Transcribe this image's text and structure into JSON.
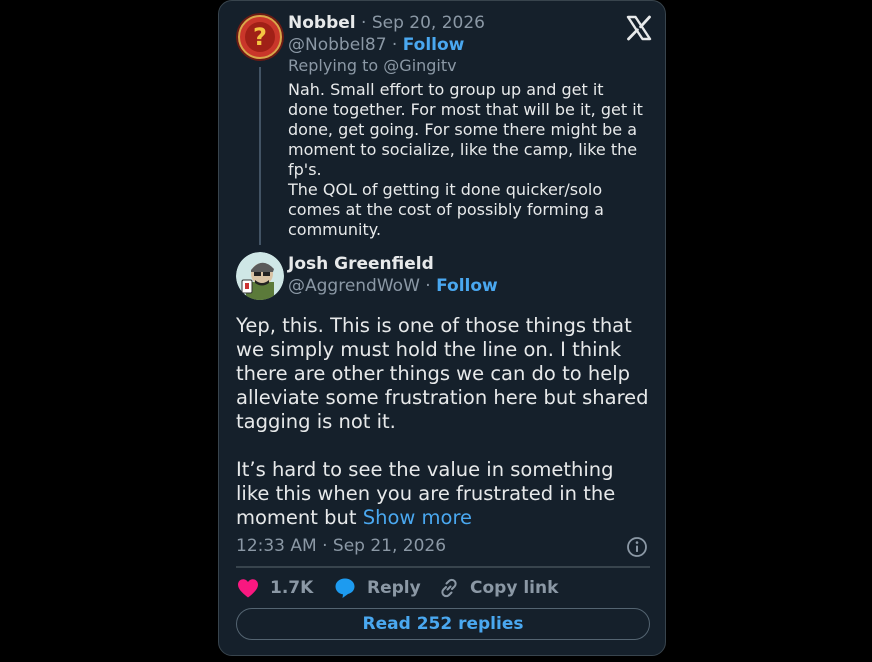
{
  "quoted": {
    "author_name": "Nobbel",
    "date": "· Sep 20, 2026",
    "handle": "@Nobbel87 ·",
    "follow_label": "Follow",
    "replying_to": "Replying to @Gingitv",
    "text_lines": [
      "Nah. Small effort to group up and get it done together. For most that will be it, get it done, get going. For some there might be a moment to socialize, like the camp, like the fp's.",
      "The QOL of getting it done quicker/solo comes at the cost of possibly forming a community."
    ]
  },
  "tweet": {
    "author_name": "Josh Greenfield",
    "handle": "@AggrendWoW ·",
    "follow_label": "Follow",
    "paragraph_1": "Yep, this. This is one of those things that we simply must hold the line on. I think there are other things we can do to help alleviate some frustration here but shared tagging is not it.",
    "paragraph_2": "It’s hard to see the value in something like this when you are frustrated in the moment but",
    "show_more_label": "Show more",
    "timestamp": "12:33 AM · Sep 21, 2026"
  },
  "actions": {
    "likes": "1.7K",
    "reply_label": "Reply",
    "copy_link_label": "Copy link"
  },
  "read_replies_label": "Read 252 replies",
  "icons": {
    "close": "x-logo-icon",
    "info": "info-icon",
    "heart": "heart-icon",
    "reply": "speech-bubble-icon",
    "link": "link-icon"
  },
  "colors": {
    "background": "#15202b",
    "accent": "#4aa8f0",
    "heart": "#f91880",
    "muted": "#8b98a5"
  }
}
